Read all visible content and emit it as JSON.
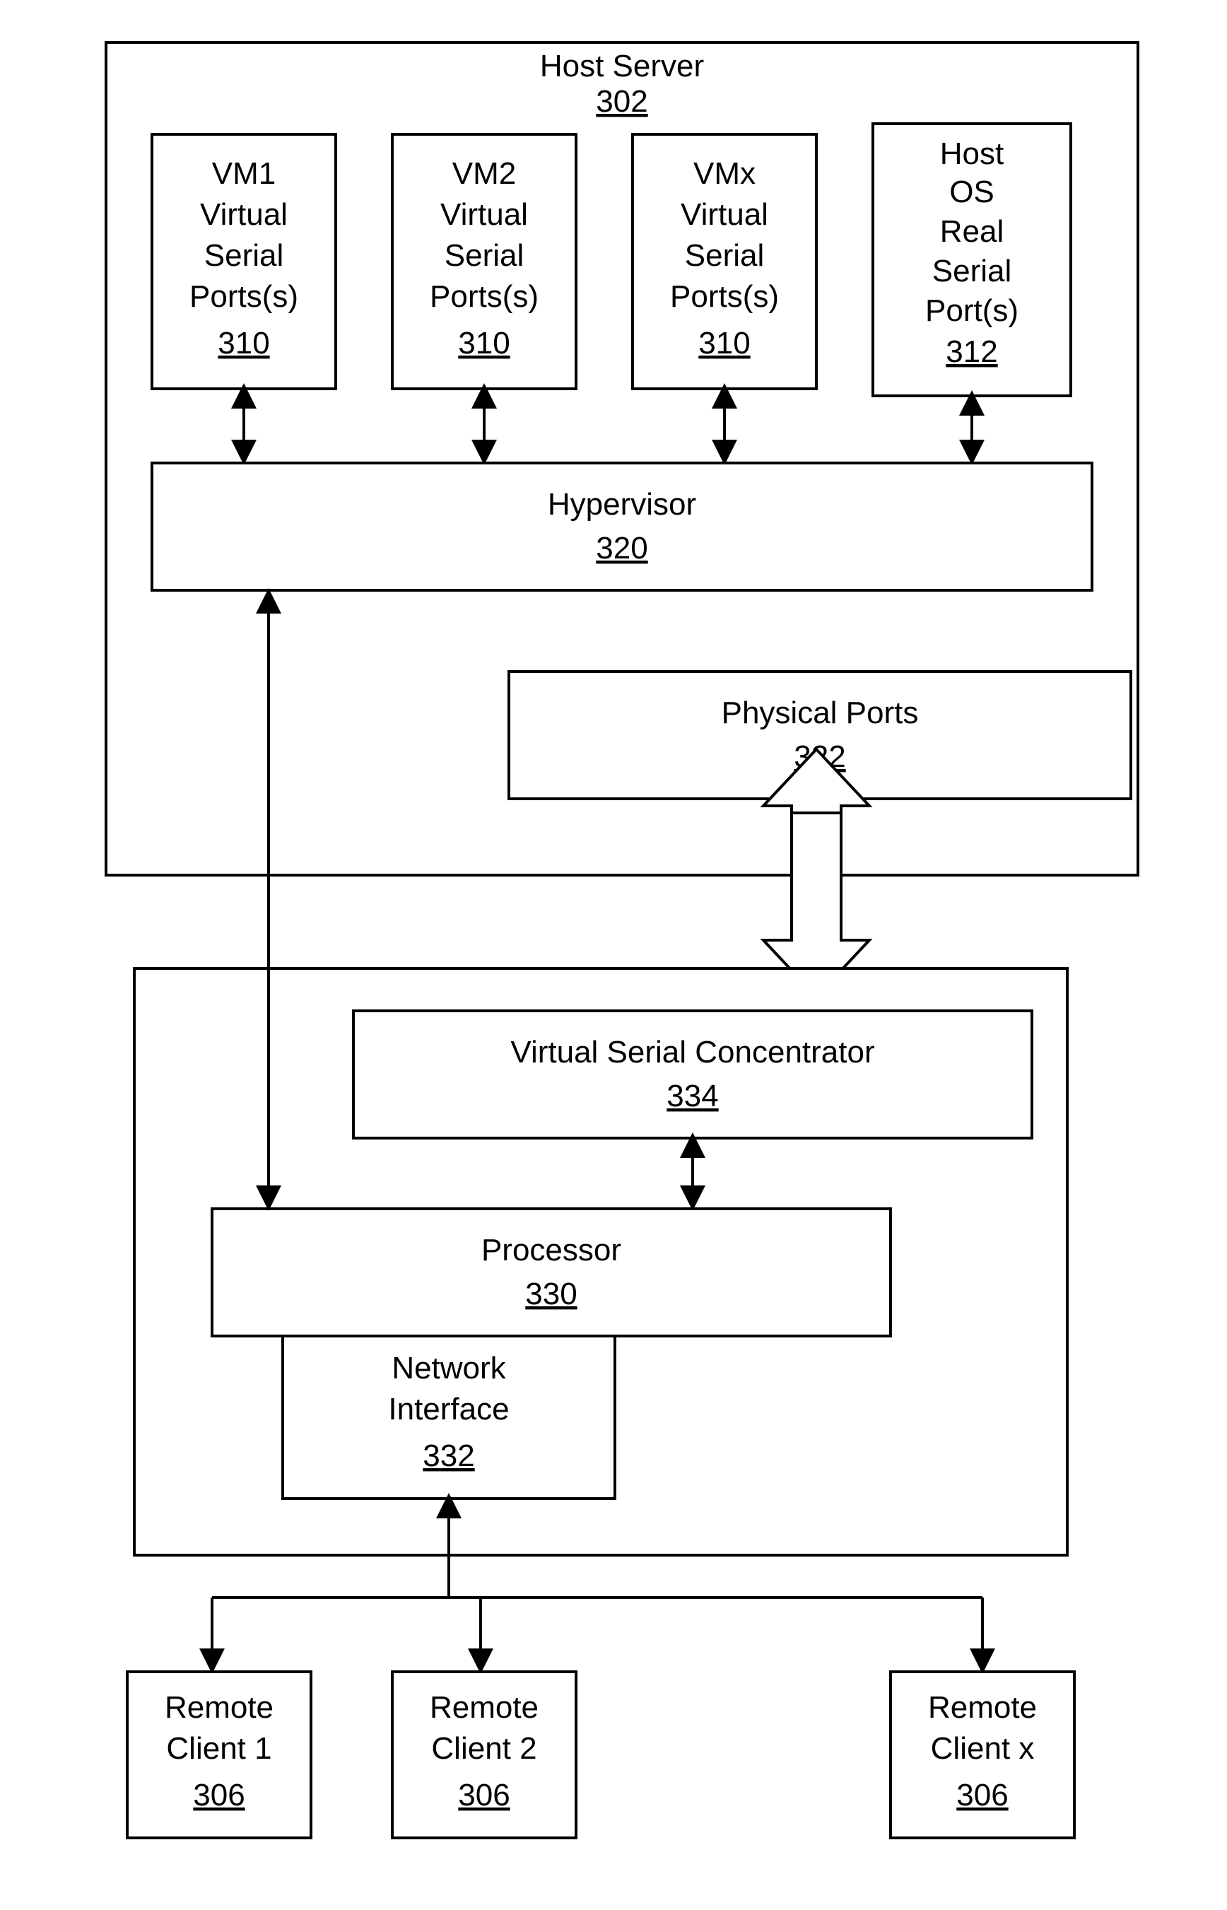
{
  "hostServer": {
    "title": "Host Server",
    "id": "302"
  },
  "vm1": {
    "l1": "VM1",
    "l2": "Virtual",
    "l3": "Serial",
    "l4": "Ports(s)",
    "id": "310"
  },
  "vm2": {
    "l1": "VM2",
    "l2": "Virtual",
    "l3": "Serial",
    "l4": "Ports(s)",
    "id": "310"
  },
  "vmx": {
    "l1": "VMx",
    "l2": "Virtual",
    "l3": "Serial",
    "l4": "Ports(s)",
    "id": "310"
  },
  "hostos": {
    "l1": "Host",
    "l2": "OS",
    "l3": "Real",
    "l4": "Serial",
    "l5": "Port(s)",
    "id": "312"
  },
  "hypervisor": {
    "title": "Hypervisor",
    "id": "320"
  },
  "physPorts": {
    "title": "Physical Ports",
    "id": "322"
  },
  "vsc": {
    "title": "Virtual Serial Concentrator",
    "id": "334"
  },
  "processor": {
    "title": "Processor",
    "id": "330"
  },
  "netif": {
    "l1": "Network",
    "l2": "Interface",
    "id": "332"
  },
  "rc1": {
    "l1": "Remote",
    "l2": "Client 1",
    "id": "306"
  },
  "rc2": {
    "l1": "Remote",
    "l2": "Client 2",
    "id": "306"
  },
  "rcx": {
    "l1": "Remote",
    "l2": "Client x",
    "id": "306"
  }
}
